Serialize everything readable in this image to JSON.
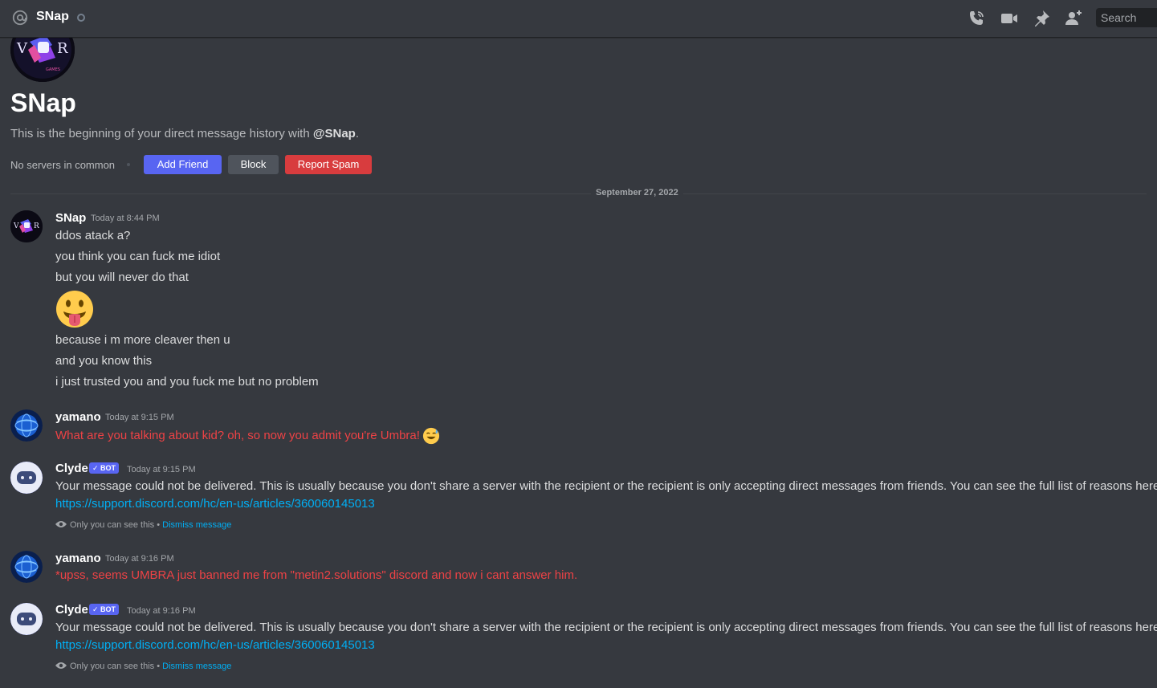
{
  "header": {
    "title": "SNap",
    "search_placeholder": "Search"
  },
  "intro": {
    "name": "SNap",
    "desc_prefix": "This is the beginning of your direct message history with ",
    "desc_mention": "@SNap",
    "desc_suffix": ".",
    "no_servers": "No servers in common",
    "add_friend": "Add Friend",
    "block": "Block",
    "report_spam": "Report Spam",
    "avatar_logo_text": "V R GAMES"
  },
  "divider": {
    "date": "September 27, 2022"
  },
  "messages": [
    {
      "author": "SNap",
      "timestamp": "Today at 8:44 PM",
      "lines": [
        "ddos atack a?",
        "you think you can fuck me idiot",
        "but you will never do that",
        "because i m more cleaver then u",
        "and you know this",
        "i just trusted you and you fuck me but no problem"
      ]
    },
    {
      "author": "yamano",
      "timestamp": "Today at 9:15 PM",
      "text": "What are you talking about kid? oh, so now you admit you're Umbra!"
    },
    {
      "author": "Clyde",
      "badge": "BOT",
      "timestamp": "Today at 9:15 PM",
      "text": "Your message could not be delivered. This is usually because you don't share a server with the recipient or the recipient is only accepting direct messages from friends. You can see the full list of reasons here:",
      "link": "https://support.discord.com/hc/en-us/articles/360060145013",
      "ephemeral": "Only you can see this •",
      "dismiss": "Dismiss message"
    },
    {
      "author": "yamano",
      "timestamp": "Today at 9:16 PM",
      "text": "*upss, seems UMBRA just banned me from \"metin2.solutions\" discord and now i cant answer him."
    },
    {
      "author": "Clyde",
      "badge": "BOT",
      "timestamp": "Today at 9:16 PM",
      "text": "Your message could not be delivered. This is usually because you don't share a server with the recipient or the recipient is only accepting direct messages from friends. You can see the full list of reasons here:",
      "link": "https://support.discord.com/hc/en-us/articles/360060145013",
      "ephemeral": "Only you can see this •",
      "dismiss": "Dismiss message"
    }
  ],
  "icons": {
    "header": [
      "at-icon",
      "status-icon",
      "voice-call-icon",
      "video-call-icon",
      "pin-icon",
      "add-member-icon"
    ],
    "accent": "#5865f2",
    "danger": "#d83c3e",
    "link": "#00aff4"
  }
}
